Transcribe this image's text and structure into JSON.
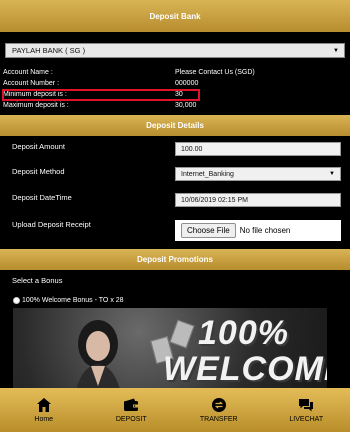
{
  "deposit_bank": {
    "title": "Deposit Bank",
    "selected_bank": "PAYLAH BANK ( SG )",
    "account_name_label": "Account Name :",
    "account_name_value": "Please Contact Us (SGD)",
    "account_number_label": "Account Number :",
    "account_number_value": "000000",
    "min_deposit_label": "Minimum deposit is :",
    "min_deposit_value": "30",
    "max_deposit_label": "Maximum deposit is :",
    "max_deposit_value": "30,000"
  },
  "deposit_details": {
    "title": "Deposit Details",
    "amount_label": "Deposit Amount",
    "amount_value": "100.00",
    "method_label": "Deposit Method",
    "method_value": "Internet_Banking",
    "datetime_label": "Deposit DateTime",
    "datetime_value": "10/06/2019 02:15 PM",
    "receipt_label": "Upload Deposit Receipt",
    "choose_file_label": "Choose File",
    "no_file_text": "No file chosen"
  },
  "deposit_promotions": {
    "title": "Deposit Promotions",
    "select_bonus_label": "Select a Bonus",
    "option_label": "100% Welcome Bonus - TO x 28",
    "banner_pct": "100%",
    "banner_word": "WELCOME"
  },
  "bottom_nav": {
    "items": [
      {
        "label": "Home",
        "icon": "home-icon"
      },
      {
        "label": "DEPOSIT",
        "icon": "wallet-icon"
      },
      {
        "label": "TRANSFER",
        "icon": "transfer-icon"
      },
      {
        "label": "LIVECHAT",
        "icon": "chat-icon"
      }
    ]
  },
  "colors": {
    "gold": "#c9a040",
    "highlight": "#e0132b",
    "background": "#000000"
  }
}
